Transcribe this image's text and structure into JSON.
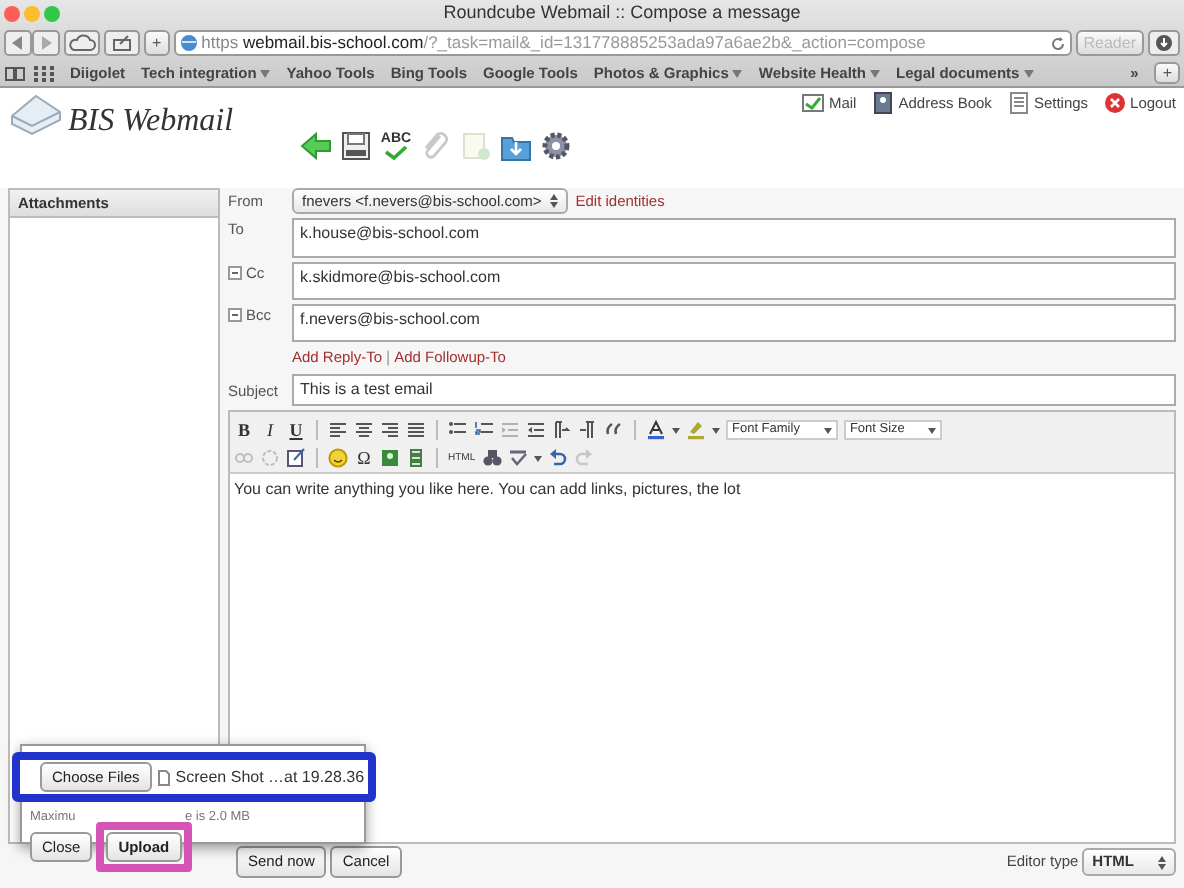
{
  "browser": {
    "title": "Roundcube Webmail :: Compose a message",
    "url_scheme": "https",
    "url_host": "webmail.bis-school.com",
    "url_path": "/?_task=mail&_id=131778885253ada97a6ae2b&_action=compose",
    "reader": "Reader",
    "overflow": "»",
    "new_tab": "+",
    "bookmarks": [
      {
        "label": "Diigolet",
        "menu": false
      },
      {
        "label": "Tech integration",
        "menu": true
      },
      {
        "label": "Yahoo Tools",
        "menu": false
      },
      {
        "label": "Bing Tools",
        "menu": false
      },
      {
        "label": "Google Tools",
        "menu": false
      },
      {
        "label": "Photos & Graphics",
        "menu": true
      },
      {
        "label": "Website Health",
        "menu": true
      },
      {
        "label": "Legal documents",
        "menu": true
      }
    ]
  },
  "app": {
    "logo": "BIS Webmail",
    "nav": [
      {
        "label": "Mail",
        "kind": "mail"
      },
      {
        "label": "Address Book",
        "kind": "contacts"
      },
      {
        "label": "Settings",
        "kind": "settings"
      },
      {
        "label": "Logout",
        "kind": "logout"
      }
    ]
  },
  "toolbar": [
    {
      "kind": "back",
      "disabled": false
    },
    {
      "kind": "save",
      "disabled": false
    },
    {
      "kind": "spell",
      "label": "ABC",
      "disabled": false
    },
    {
      "kind": "attach",
      "disabled": true
    },
    {
      "kind": "signature",
      "disabled": true
    },
    {
      "kind": "folder",
      "disabled": false
    },
    {
      "kind": "gear",
      "disabled": false
    }
  ],
  "attachments": {
    "title": "Attachments"
  },
  "compose": {
    "from_label": "From",
    "from": "fnevers <f.nevers@bis-school.com>",
    "edit_identities": "Edit identities",
    "recipients": [
      {
        "label": "To",
        "value": "k.house@bis-school.com",
        "removable": false
      },
      {
        "label": "Cc",
        "value": "k.skidmore@bis-school.com",
        "removable": true
      },
      {
        "label": "Bcc",
        "value": "f.nevers@bis-school.com",
        "removable": true
      }
    ],
    "links": [
      "Add Reply-To",
      "Add Followup-To"
    ],
    "link_separator": "|",
    "subject_label": "Subject",
    "subject": "This is a test email",
    "body": "You can write anything you like here. You can add links, pictures, the lot"
  },
  "editor_toolbar": [
    [
      {
        "kind": "bold",
        "label": "B"
      },
      {
        "kind": "italic",
        "label": "I"
      },
      {
        "kind": "underline",
        "label": "U"
      },
      {
        "kind": "sep"
      },
      {
        "kind": "align-left"
      },
      {
        "kind": "align-center"
      },
      {
        "kind": "align-right"
      },
      {
        "kind": "justify"
      },
      {
        "kind": "sep"
      },
      {
        "kind": "bullets"
      },
      {
        "kind": "numbers"
      },
      {
        "kind": "outdent",
        "disabled": true
      },
      {
        "kind": "indent"
      },
      {
        "kind": "ltr"
      },
      {
        "kind": "rtl"
      },
      {
        "kind": "quote"
      },
      {
        "kind": "sep"
      },
      {
        "kind": "text-color"
      },
      {
        "kind": "highlight"
      },
      {
        "kind": "select",
        "label": "Font Family"
      },
      {
        "kind": "select",
        "label": "Font Size"
      }
    ],
    [
      {
        "kind": "link",
        "disabled": true
      },
      {
        "kind": "unlink",
        "disabled": true
      },
      {
        "kind": "edit"
      },
      {
        "kind": "sep"
      },
      {
        "kind": "smiley"
      },
      {
        "kind": "symbol",
        "label": "Ω"
      },
      {
        "kind": "image"
      },
      {
        "kind": "media"
      },
      {
        "kind": "sep"
      },
      {
        "kind": "source",
        "label": "HTML"
      },
      {
        "kind": "find"
      },
      {
        "kind": "spellcheck"
      },
      {
        "kind": "undo"
      },
      {
        "kind": "redo",
        "disabled": true
      }
    ]
  ],
  "footer": {
    "send": "Send now",
    "cancel": "Cancel",
    "editor_type_label": "Editor type",
    "editor_type": "HTML"
  },
  "upload_dialog": {
    "file_button": "Choose Files",
    "file_name": "Screen Shot …at 19.28.36",
    "note_parts": [
      "Maximu",
      "e is 2.0 MB"
    ],
    "close": "Close",
    "upload": "Upload"
  }
}
